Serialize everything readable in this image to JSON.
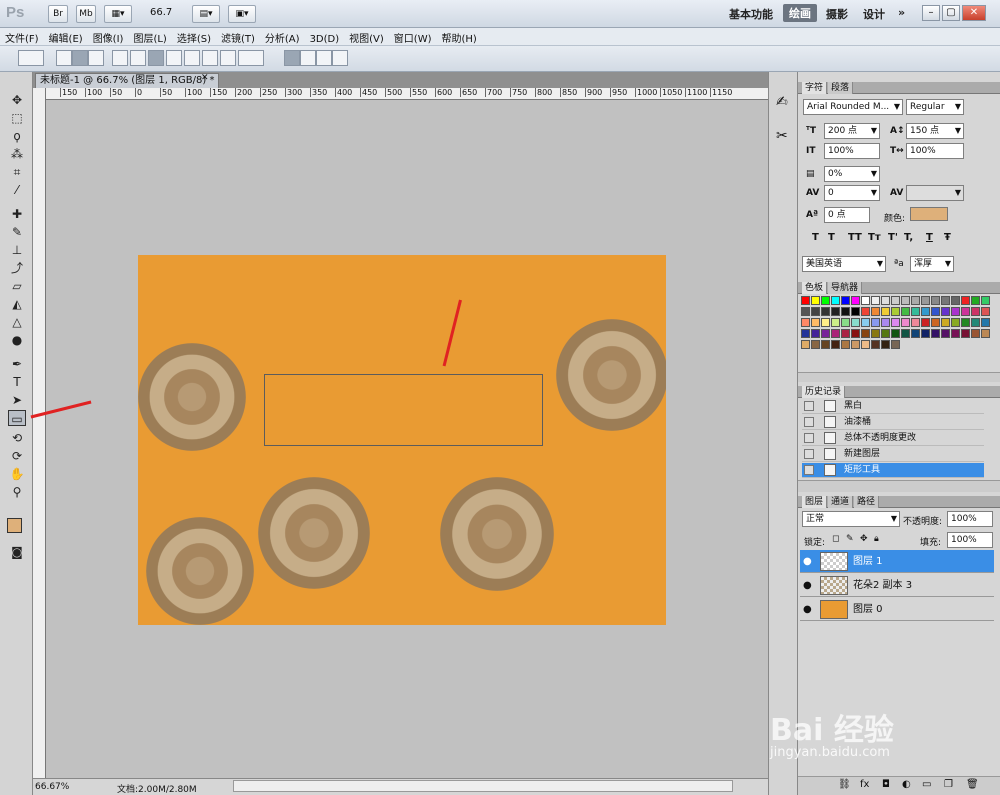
{
  "titlebar": {
    "logo": "Ps",
    "bridge": "Br",
    "minibridge": "Mb",
    "zoom": "66.7",
    "workspaces": [
      "基本功能",
      "绘画",
      "摄影",
      "设计"
    ],
    "active_workspace": "绘画",
    "more": "»"
  },
  "menu": [
    "文件(F)",
    "编辑(E)",
    "图像(I)",
    "图层(L)",
    "选择(S)",
    "滤镜(T)",
    "分析(A)",
    "3D(D)",
    "视图(V)",
    "窗口(W)",
    "帮助(H)"
  ],
  "document": {
    "tab_title": "未标题-1 @ 66.7% (图层 1, RGB/8) *",
    "ruler_top": [
      "150",
      "100",
      "50",
      "0",
      "50",
      "100",
      "150",
      "200",
      "250",
      "300",
      "350",
      "400",
      "450",
      "500",
      "550",
      "600",
      "650",
      "700",
      "750",
      "800",
      "850",
      "900",
      "950",
      "1000",
      "1050",
      "1100",
      "1150"
    ],
    "status_zoom": "66.67%",
    "status_doc": "文档:2.00M/2.80M"
  },
  "character": {
    "tabs": [
      "字符",
      "段落"
    ],
    "font_family": "Arial Rounded M...",
    "font_style": "Regular",
    "size": "200 点",
    "leading": "150 点",
    "vscale": "100%",
    "hscale": "100%",
    "tracking_pct": "0%",
    "kerning": "0",
    "baseline": "0 点",
    "color_label": "颜色:",
    "color": "#deb07a",
    "style_buttons": [
      "T",
      "T",
      "TT",
      "Tт",
      "T'",
      "T,",
      "T",
      "Ŧ"
    ],
    "language": "美国英语",
    "aa_label": "ªa",
    "antialias": "浑厚"
  },
  "swatch_panel": {
    "tabs": [
      "色板",
      "导航器"
    ]
  },
  "history": {
    "tab": "历史记录",
    "items": [
      "黑白",
      "油漆桶",
      "总体不透明度更改",
      "新建图层",
      "矩形工具"
    ],
    "selected": "矩形工具"
  },
  "layers": {
    "tabs": [
      "图层",
      "通道",
      "路径"
    ],
    "blend_mode": "正常",
    "opacity_label": "不透明度:",
    "opacity": "100%",
    "lock_label": "锁定:",
    "fill_label": "填充:",
    "fill": "100%",
    "items": [
      "图层 1",
      "花朵2 副本 3",
      "图层 0"
    ],
    "selected": "图层 1"
  },
  "watermark": {
    "brand": "Bai 经验",
    "url": "jingyan.baidu.com"
  },
  "colors": {
    "canvas_bg": "#e99b33",
    "foreground": "#deb07a",
    "background": "#22cc22",
    "accent": "#3a8ee6"
  }
}
